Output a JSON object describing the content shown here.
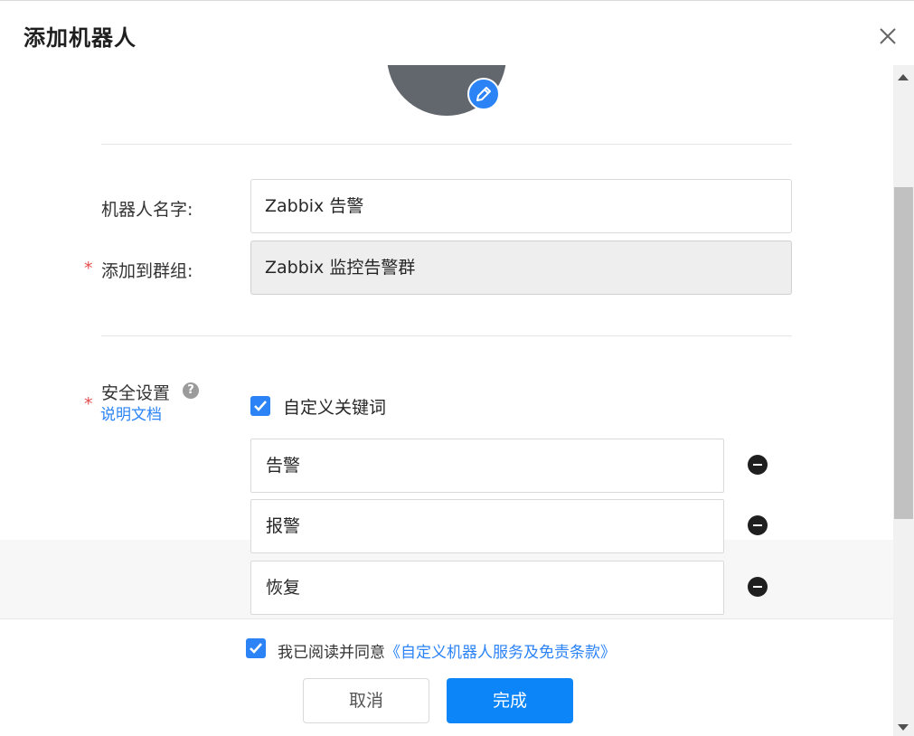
{
  "dialog": {
    "title": "添加机器人"
  },
  "form": {
    "robot_name_label": "机器人名字:",
    "robot_name_value": "Zabbix 告警",
    "group_label": "添加到群组:",
    "group_value": "Zabbix 监控告警群",
    "required_mark": "*"
  },
  "security": {
    "label": "安全设置",
    "help_glyph": "?",
    "doc_link": "说明文档",
    "custom_keyword_label": "自定义关键词",
    "custom_keyword_checked": true,
    "keywords": [
      "告警",
      "报警",
      "恢复"
    ]
  },
  "footer": {
    "agree_checked": true,
    "agree_prefix": "我已阅读并同意",
    "agree_link": "《自定义机器人服务及免责条款》",
    "cancel_label": "取消",
    "done_label": "完成"
  },
  "colors": {
    "accent": "#0b85f7",
    "required": "#e34d4d",
    "avatar": "#62666d"
  },
  "icons": {
    "close": "close-icon",
    "edit": "pencil-icon",
    "help": "question-circle-icon",
    "check": "checkmark-icon",
    "remove": "minus-circle-icon"
  }
}
